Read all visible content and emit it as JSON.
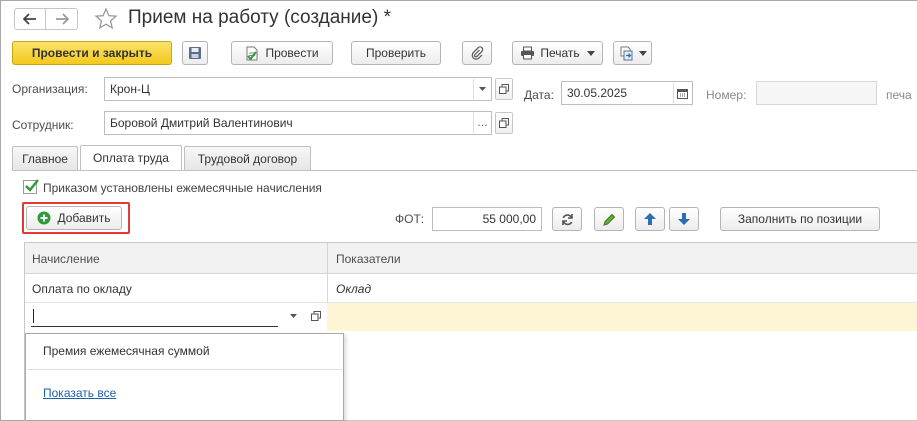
{
  "window": {
    "title": "Прием на работу (создание) *"
  },
  "toolbar": {
    "post_close_label": "Провести и закрыть",
    "post_label": "Провести",
    "check_label": "Проверить",
    "print_label": "Печать"
  },
  "header": {
    "org_label": "Организация:",
    "org_value": "Крон-Ц",
    "date_label": "Дата:",
    "date_value": "30.05.2025",
    "number_label": "Номер:",
    "number_value": "",
    "print_cut_label": "печа",
    "employee_label": "Сотрудник:",
    "employee_value": "Боровой Дмитрий Валентинович"
  },
  "tabs": [
    {
      "label": "Главное"
    },
    {
      "label": "Оплата труда"
    },
    {
      "label": "Трудовой договор"
    }
  ],
  "payment": {
    "checkbox_label": "Приказом установлены ежемесячные начисления",
    "add_label": "Добавить",
    "fot_label": "ФОТ:",
    "fot_value": "55 000,00",
    "fill_label": "Заполнить по позиции"
  },
  "table": {
    "columns": [
      "Начисление",
      "Показатели"
    ],
    "rows": [
      {
        "accrual": "Оплата по окладу",
        "indicators": "Оклад"
      }
    ],
    "edit_value": ""
  },
  "dropdown": {
    "items": [
      "Премия ежемесячная суммой"
    ],
    "show_all": "Показать все"
  },
  "colors": {
    "accent_yellow": "#f3c91c",
    "highlight_red": "#e53935",
    "selected_row": "#fdf5d4",
    "link_blue": "#1f5fa8",
    "check_green": "#2e9a3c"
  }
}
